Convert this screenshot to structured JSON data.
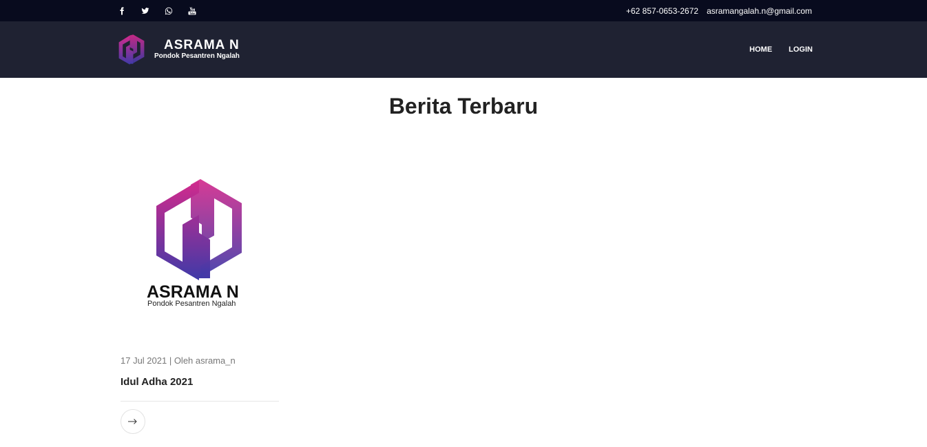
{
  "topbar": {
    "social": [
      {
        "name": "facebook-icon"
      },
      {
        "name": "twitter-icon"
      },
      {
        "name": "whatsapp-icon"
      },
      {
        "name": "youtube-icon"
      }
    ],
    "phone": "+62 857-0653-2672",
    "email": "asramangalah.n@gmail.com"
  },
  "navbar": {
    "brand_name": "ASRAMA N",
    "brand_subtitle": "Pondok Pesantren Ngalah",
    "links": [
      "HOME",
      "LOGIN"
    ]
  },
  "section": {
    "title": "Berita Terbaru"
  },
  "posts": [
    {
      "image": {
        "brand_name": "ASRAMA N",
        "brand_subtitle": "Pondok Pesantren Ngalah"
      },
      "meta": "17 Jul 2021 | Oleh asrama_n",
      "title": "Idul Adha 2021",
      "action_icon": "arrow-right-icon"
    }
  ],
  "colors": {
    "topbar_bg": "#080b1e",
    "navbar_bg": "#1f2232",
    "logo_gradient_top": "#d42a8c",
    "logo_gradient_bottom": "#3e3aa8"
  }
}
